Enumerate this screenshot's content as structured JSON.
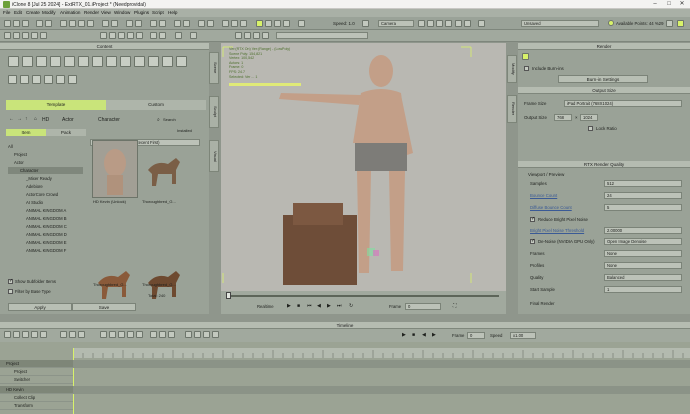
{
  "window": {
    "title": "iClone 8 [Jul 25 2024] - ExtRTX_01.iProject * (Needprovidal)",
    "minimize": "–",
    "maximize": "□",
    "close": "✕"
  },
  "menu": [
    "File",
    "Edit",
    "Create",
    "Modify",
    "Animation",
    "Render",
    "View",
    "Window",
    "Plugins",
    "Script",
    "Help"
  ],
  "toolbar": {
    "speed_label": "Speed: 1.0",
    "camera_label": "Camera",
    "render_mode": "Unsaved",
    "points_label": "Available Points: 44 %29"
  },
  "content": {
    "title": "Content",
    "tabs": [
      "Template",
      "Custom"
    ],
    "search_placeholder": "Search",
    "installed_label": "Installed",
    "breadcrumb": [
      "HD",
      "Actor",
      "Character"
    ],
    "list_tabs": [
      "Item",
      "Pack"
    ],
    "sort_label": "Sort by Installed Date (Recent First)",
    "tree": [
      "All",
      "Project",
      "Actor",
      "Character",
      "_Mixer Ready",
      "Adebiore",
      "ActorCore Crowd",
      "AI Studio",
      "ANIMAL KINGDOM A",
      "ANIMAL KINGDOM B",
      "ANIMAL KINGDOM C",
      "ANIMAL KINGDOM D",
      "ANIMAL KINGDOM E",
      "ANIMAL KINGDOM F"
    ],
    "thumbs": [
      "HD Kevin (Unlock)",
      "Thoroughbred_G...",
      "Thoroughbred_G...",
      "Thoroughbred_G..."
    ],
    "show_subfolder": "Show Subfolder Items",
    "filter_label": "Filter by Base Type",
    "total_label": "Total: 240",
    "apply": "Apply",
    "save": "Save"
  },
  "side_tabs": [
    "Scene",
    "Sculpt",
    "Visual"
  ],
  "right_tabs": [
    "Modify",
    "Render"
  ],
  "viewport": {
    "stats": [
      "Ver:(RTX On) Ver:(Range) - (LowPoly)",
      "Scene Poly: 154,821",
      "Vertex: 100,542",
      "Actors: 1",
      "Frame: 0",
      "FPS: 24.7",
      "Selected: Ver ... 1"
    ],
    "render_label": "Realtime",
    "frame_label": "Frame"
  },
  "render": {
    "title": "Render",
    "include_burn": "Include Burn-ins",
    "burnin_settings": "Burn-in Settings",
    "output_size_title": "Output Size",
    "frame_size_label": "Frame Size",
    "frame_size_value": "iPad Portrait (768X1024)",
    "output_size_label": "Output Size",
    "width": "768",
    "height": "1024",
    "lock_ratio": "Lock Ratio",
    "rtx_title": "RTX Render Quality",
    "viewport_preview": "Viewport / Preview",
    "rows": [
      {
        "label": "Samples",
        "value": "512"
      },
      {
        "label": "Bounce Count",
        "value": "24"
      },
      {
        "label": "Diffuse Bounce Count",
        "value": "5"
      },
      {
        "label": "Reduce Bright Pixel Noise",
        "value": ""
      },
      {
        "label": "Bright Pixel Noise Threshold",
        "value": "2.00000"
      },
      {
        "label": "De-Noise (NVIDIA GPU Only)",
        "value": "Open Image Denoise"
      },
      {
        "label": "Frames",
        "value": "None"
      },
      {
        "label": "Profiles",
        "value": "None"
      },
      {
        "label": "Quality",
        "value": "Balanced"
      },
      {
        "label": "Start Sample",
        "value": "1"
      }
    ],
    "final_render": "Final Render"
  },
  "timeline": {
    "title": "Timeline",
    "frame_label": "Frame",
    "frame_value": "0",
    "speed_label": "Speed",
    "speed_value": "x1.00",
    "rows": [
      "Project",
      "Project",
      "Switcher",
      "HD Kevin",
      "Collect Clip",
      "Transform"
    ]
  },
  "colors": {
    "accent": "#d8f26a",
    "panel": "#9aa297"
  }
}
